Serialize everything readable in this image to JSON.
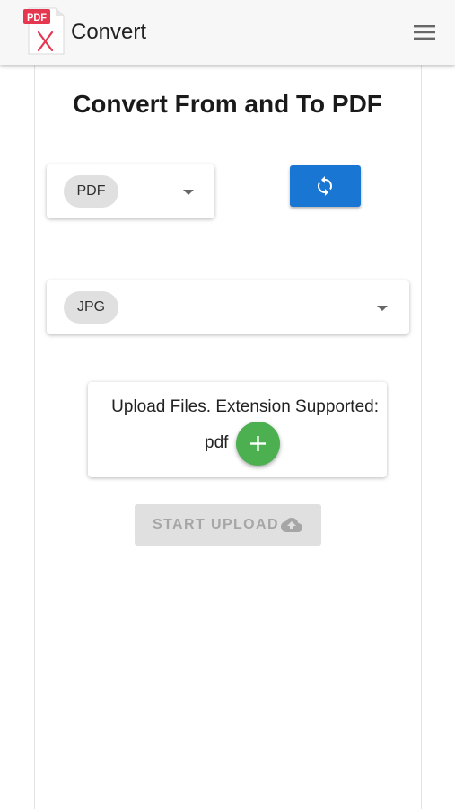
{
  "app_bar": {
    "logo_text": "PDF",
    "title": "Convert",
    "menu_icon": "hamburger-menu-icon"
  },
  "main": {
    "heading": "Convert From and To PDF",
    "from_select": {
      "value": "PDF"
    },
    "swap_button": {
      "icon": "refresh-swap-icon"
    },
    "to_select": {
      "value": "JPG"
    },
    "upload": {
      "label": "Upload Files. Extension Supported:",
      "extension": "pdf",
      "add_icon": "plus-icon"
    },
    "start_upload": {
      "label": "START UPLOAD",
      "icon": "cloud-upload-icon",
      "disabled": true
    }
  },
  "colors": {
    "accent_blue": "#1976d2",
    "add_green": "#4caf50",
    "logo_red": "#e5374f",
    "disabled_gray": "#e0e0e0"
  }
}
